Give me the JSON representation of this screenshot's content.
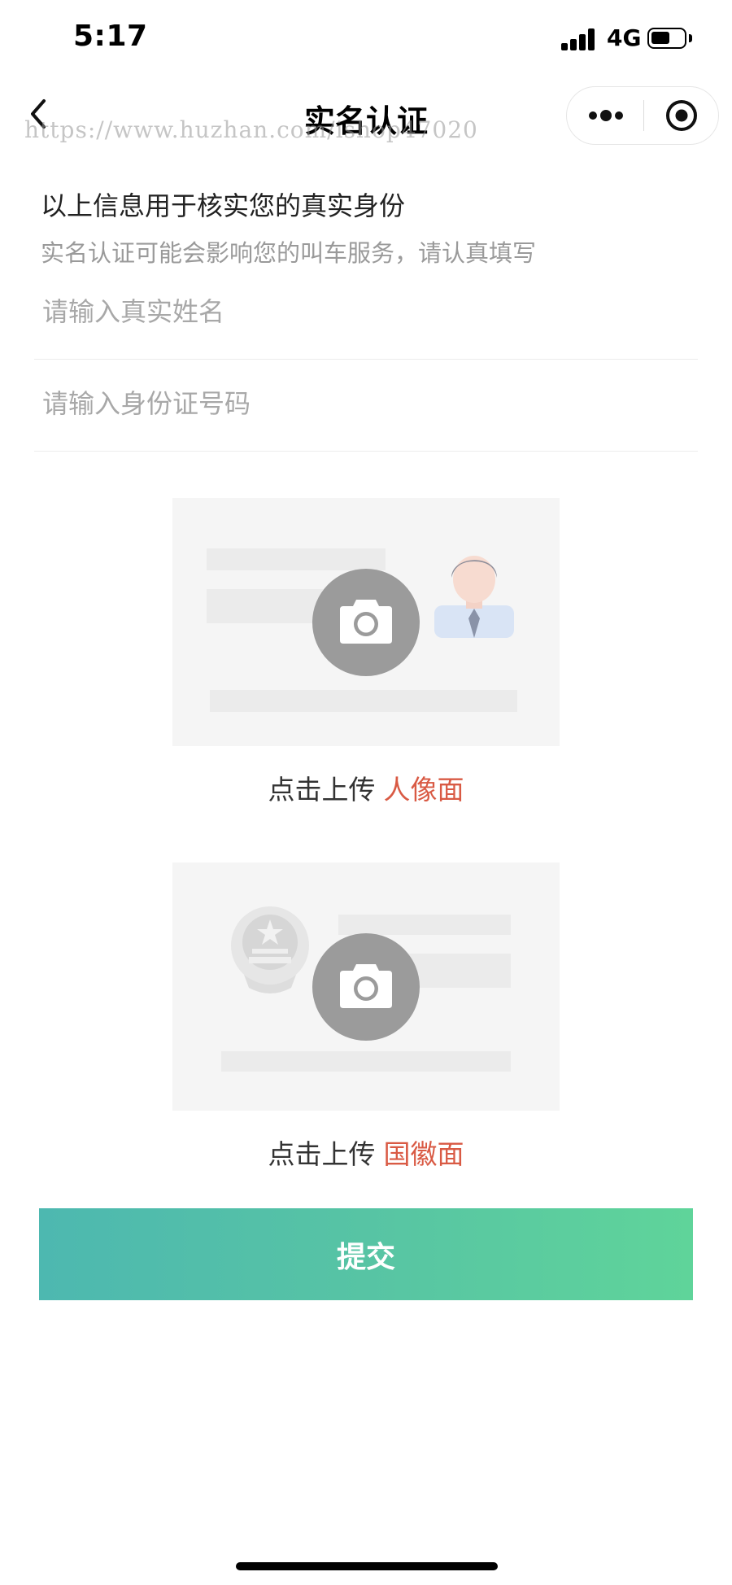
{
  "status_bar": {
    "time": "5:17",
    "network": "4G"
  },
  "nav": {
    "title": "实名认证",
    "watermark": "https://www.huzhan.com/ishop47020"
  },
  "form": {
    "heading": "以上信息用于核实您的真实身份",
    "subheading": "实名认证可能会影响您的叫车服务，请认真填写",
    "name_field": {
      "placeholder": "请输入真实姓名",
      "value": ""
    },
    "id_field": {
      "placeholder": "请输入身份证号码",
      "value": ""
    }
  },
  "uploads": {
    "front": {
      "prefix": "点击上传",
      "side": "人像面"
    },
    "back": {
      "prefix": "点击上传",
      "side": "国徽面"
    }
  },
  "submit": {
    "label": "提交"
  },
  "colors": {
    "accent_red": "#d95a44",
    "submit_gradient_start": "#4db8b0",
    "submit_gradient_end": "#5fd49a",
    "camera_gray": "#9b9b9b"
  }
}
